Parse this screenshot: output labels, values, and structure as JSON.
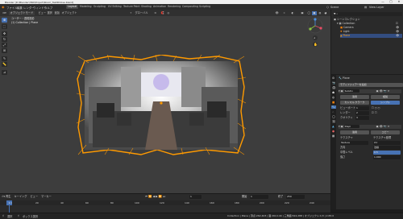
{
  "window": {
    "title": "Blender [D:\\Blender\\360\\Project\\Room_TestRClose.blend]",
    "minimize": "—",
    "maximize": "□",
    "close": "✕"
  },
  "menu": [
    "ファイル",
    "編集",
    "レンダー",
    "ウィンドウ",
    "ヘルプ"
  ],
  "workspace_tabs": [
    {
      "label": "Layout",
      "active": true
    },
    {
      "label": "Modeling",
      "active": false
    },
    {
      "label": "Sculpting",
      "active": false
    },
    {
      "label": "UV Editing",
      "active": false
    },
    {
      "label": "Texture Paint",
      "active": false
    },
    {
      "label": "Shading",
      "active": false
    },
    {
      "label": "Animation",
      "active": false
    },
    {
      "label": "Rendering",
      "active": false
    },
    {
      "label": "Compositing",
      "active": false
    },
    {
      "label": "Scripting",
      "active": false
    }
  ],
  "scene": {
    "label": "Scene",
    "view_layer": "View Layer"
  },
  "viewport_header": {
    "mode": "オブジェクトモード",
    "menus": [
      "ビュー",
      "選択",
      "追加",
      "オブジェクト"
    ],
    "orientation": "グローバル"
  },
  "viewport_overlay_text": {
    "line1": "ユーザー・透視投影",
    "line2": "(1) Collection | Plane"
  },
  "tools": [
    "⊕",
    "⬚",
    "✥",
    "↻",
    "⤢",
    "⊞",
    "✎",
    "📏",
    "⊿"
  ],
  "outliner": {
    "title": "シーンコレクション",
    "items": [
      {
        "label": "Collection",
        "depth": 1
      },
      {
        "label": "Camera",
        "depth": 2
      },
      {
        "label": "Light",
        "depth": 2
      },
      {
        "label": "Plane",
        "depth": 2
      }
    ]
  },
  "properties": {
    "object_name": "Plane",
    "section": "モディファイアーを追加",
    "modifier1": {
      "name": "Subdiv",
      "tab_simple": "カトマル-クラーク",
      "tab_simple2": "シンプル",
      "fields": [
        "ビューポート",
        "レンダー",
        "クオリティ"
      ],
      "values": [
        "1",
        "2",
        "3"
      ],
      "apply": "適用",
      "copy": "複製"
    },
    "modifier2": {
      "name": "Displ",
      "apply": "適用",
      "copy": "コピー",
      "texture_label": "テクスチャ",
      "texture": "Texture",
      "coords": "テクスチャ座標",
      "direction_label": "方向",
      "direction": "法線",
      "midlevel_label": "中間レベル",
      "midlevel": "0.5",
      "strength_label": "強さ",
      "strength": "1.000"
    }
  },
  "timeline": {
    "menus": [
      "再生",
      "キーイング",
      "ビュー",
      "マーカー"
    ],
    "frame_current": "1",
    "start_label": "開始",
    "start": "1",
    "end_label": "終了",
    "end": "250",
    "ticks": [
      "0",
      "20",
      "40",
      "60",
      "80",
      "100",
      "120",
      "140",
      "160",
      "180",
      "200",
      "220",
      "240"
    ]
  },
  "statusbar": {
    "left": "選択",
    "mid": "ボックス選択",
    "right": "Collection | Plane | 頂点:262,403 | 面:262,144 | 三角面:524,288 | オブジェクト:1/3 | 2.83.0"
  },
  "colors": {
    "accent": "#4772b3",
    "selection": "#ff9a00"
  }
}
